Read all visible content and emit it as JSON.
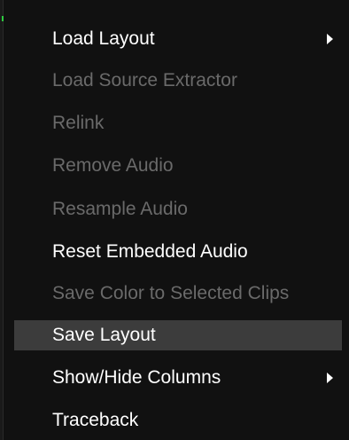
{
  "menu": {
    "items": [
      {
        "label": "Load Layout",
        "enabled": true,
        "submenu": true,
        "icon": "chevron-right-icon"
      },
      {
        "label": "Load Source Extractor",
        "enabled": false
      },
      {
        "label": "Relink",
        "enabled": false
      },
      {
        "label": "Remove Audio",
        "enabled": false
      },
      {
        "label": "Resample Audio",
        "enabled": false
      },
      {
        "label": "Reset Embedded Audio",
        "enabled": true
      },
      {
        "label": "Save Color to Selected Clips",
        "enabled": false
      },
      {
        "label": "Save Layout",
        "enabled": true,
        "highlighted": true
      },
      {
        "label": "Show/Hide Columns",
        "enabled": true,
        "submenu": true,
        "icon": "chevron-right-icon"
      },
      {
        "label": "Traceback",
        "enabled": true
      }
    ]
  },
  "colors": {
    "background": "#111111",
    "enabled_text": "#ffffff",
    "disabled_text": "#6a6a6a",
    "highlight": "#3c3c3c"
  }
}
